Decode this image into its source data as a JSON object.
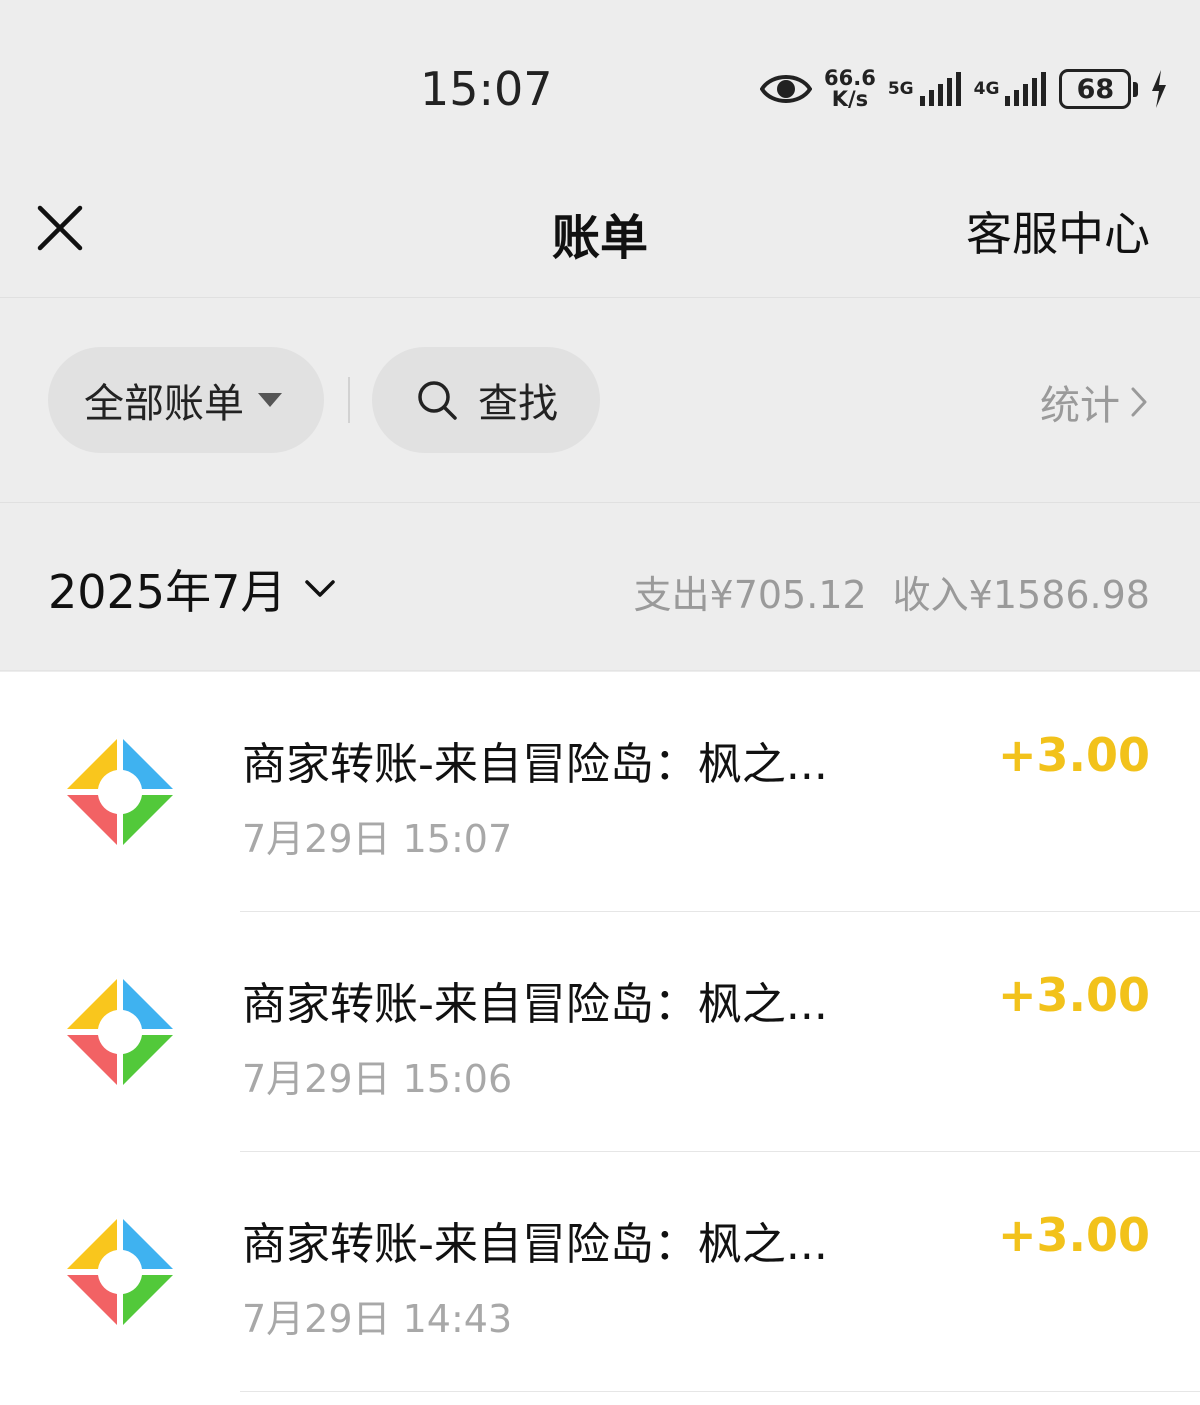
{
  "status_bar": {
    "time": "15:07",
    "net_speed_value": "66.6",
    "net_speed_unit": "K/s",
    "sig1_tag": "5G",
    "sig2_tag": "4G",
    "battery": "68"
  },
  "header": {
    "title": "账单",
    "service": "客服中心"
  },
  "filter": {
    "all_bills": "全部账单",
    "search": "查找",
    "stats": "统计"
  },
  "month": {
    "label": "2025年7月",
    "expense": "支出¥705.12",
    "income": "收入¥1586.98"
  },
  "bills": [
    {
      "title": "商家转账-来自冒险岛：枫之...",
      "time": "7月29日 15:07",
      "amount": "+3.00",
      "icon": "merchant-transfer-icon"
    },
    {
      "title": "商家转账-来自冒险岛：枫之...",
      "time": "7月29日 15:06",
      "amount": "+3.00",
      "icon": "merchant-transfer-icon"
    },
    {
      "title": "商家转账-来自冒险岛：枫之...",
      "time": "7月29日 14:43",
      "amount": "+3.00",
      "icon": "merchant-transfer-icon"
    }
  ],
  "colors": {
    "amount": "#f2c21b",
    "icon_yellow": "#f9c61d",
    "icon_blue": "#3fb2f0",
    "icon_red": "#f26264",
    "icon_green": "#52c93a"
  }
}
